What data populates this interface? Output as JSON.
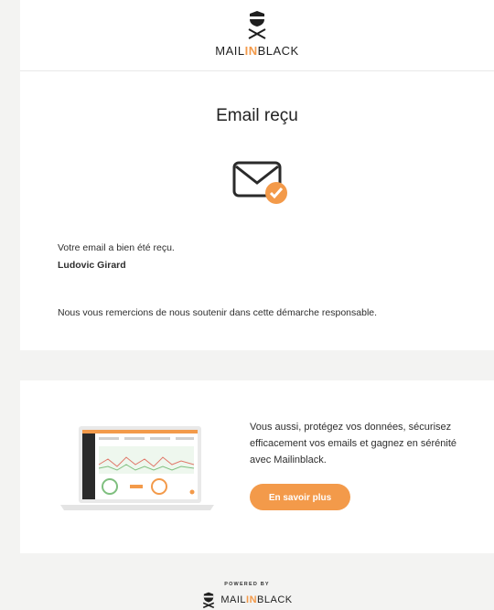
{
  "header": {
    "logo_prefix": "MAIL",
    "logo_highlight": "IN",
    "logo_suffix": "BLACK"
  },
  "main": {
    "title": "Email reçu",
    "confirmation_text": "Votre email a bien été reçu.",
    "sender_name": "Ludovic Girard",
    "thanks_text": "Nous vous remercions de nous soutenir dans cette démarche responsable."
  },
  "promo": {
    "text": "Vous aussi, protégez vos données, sécurisez efficacement vos emails et gagnez en sérénité avec Mailinblack.",
    "cta_label": "En savoir plus"
  },
  "footer": {
    "powered_by": "POWERED BY",
    "logo_prefix": "MAIL",
    "logo_highlight": "IN",
    "logo_suffix": "BLACK"
  },
  "icons": {
    "brand": "mailinblack-logo-icon",
    "mail": "envelope-check-icon",
    "promo_image": "laptop-dashboard-image"
  },
  "colors": {
    "accent": "#f39a4a",
    "background": "#f3f3f2",
    "card": "#ffffff",
    "text": "#2e2e2e"
  }
}
